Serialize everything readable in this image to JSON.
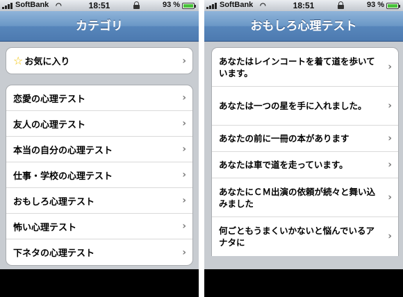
{
  "left": {
    "status": {
      "carrier": "SoftBank",
      "time": "18:51",
      "battery": "93 %",
      "battery_level": 0.93
    },
    "title": "カテゴリ",
    "favorites_label": "お気に入り",
    "categories": [
      "恋愛の心理テスト",
      "友人の心理テスト",
      "本当の自分の心理テスト",
      "仕事・学校の心理テスト",
      "おもしろ心理テスト",
      "怖い心理テスト",
      "下ネタの心理テスト"
    ]
  },
  "right": {
    "status": {
      "carrier": "SoftBank",
      "time": "18:51",
      "battery": "93 %",
      "battery_level": 0.93
    },
    "title": "おもしろ心理テスト",
    "tests": [
      "あなたはレインコートを着て道を歩いています。",
      "あなたは一つの星を手に入れました。",
      "あなたの前に一冊の本があります",
      "あなたは車で道を走っています。",
      "あなたにＣＭ出演の依頼が続々と舞い込みました",
      "何ごともうまくいかないと悩んでいるアナタに"
    ]
  },
  "icons": {
    "chevron": "›",
    "star": "☆",
    "wifi": "wifi-icon",
    "lock": "lock-icon"
  },
  "colors": {
    "navbar": "#5786bb",
    "background": "#c8ccd1",
    "star": "#f2c200"
  }
}
